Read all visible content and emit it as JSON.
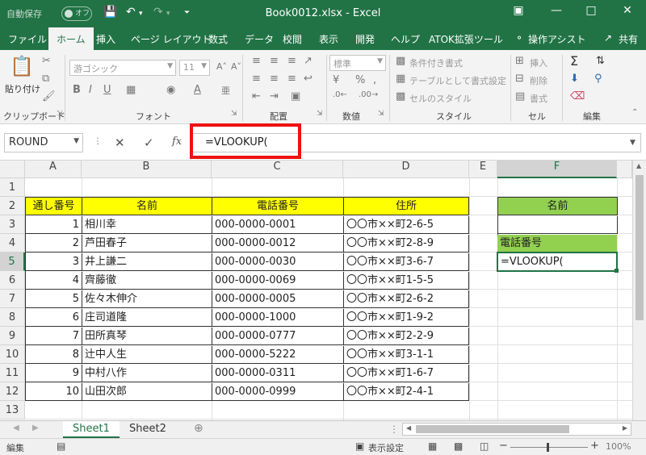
{
  "titlebar": {
    "autosave_label": "自動保存",
    "autosave_state": "オフ",
    "title": "Book0012.xlsx  -  Excel"
  },
  "ribbon_tabs": [
    "ファイル",
    "ホーム",
    "挿入",
    "ページ レイアウト",
    "数式",
    "データ",
    "校閲",
    "表示",
    "開発",
    "ヘルプ",
    "ATOK拡張ツール"
  ],
  "tell_me": "操作アシスト",
  "share": "共有",
  "ribbon": {
    "paste": "貼り付け",
    "font_name": "游ゴシック",
    "font_size": "11",
    "number_format": "標準",
    "conditional_format": "条件付き書式",
    "format_as_table": "テーブルとして書式設定",
    "cell_styles": "セルのスタイル",
    "insert": "挿入",
    "delete": "削除",
    "format": "書式",
    "groups": {
      "clipboard": "クリップボード",
      "font": "フォント",
      "alignment": "配置",
      "number": "数値",
      "styles": "スタイル",
      "cells": "セル",
      "editing": "編集"
    }
  },
  "formula_bar": {
    "name_box": "ROUND",
    "fx": "fx",
    "formula": "=VLOOKUP("
  },
  "grid": {
    "columns": [
      "A",
      "B",
      "C",
      "D",
      "E",
      "F"
    ],
    "rows": [
      "1",
      "2",
      "3",
      "4",
      "5",
      "6",
      "7",
      "8",
      "9",
      "10",
      "11",
      "12",
      "13"
    ],
    "headers": [
      "通し番号",
      "名前",
      "電話番号",
      "住所"
    ],
    "records": [
      [
        "1",
        "相川幸",
        "000-0000-0001",
        "〇〇市××町2-6-5"
      ],
      [
        "2",
        "芦田春子",
        "000-0000-0012",
        "〇〇市××町2-8-9"
      ],
      [
        "3",
        "井上謙二",
        "000-0000-0030",
        "〇〇市××町3-6-7"
      ],
      [
        "4",
        "齊藤徹",
        "000-0000-0069",
        "〇〇市××町1-5-5"
      ],
      [
        "5",
        "佐々木伸介",
        "000-0000-0005",
        "〇〇市××町2-6-2"
      ],
      [
        "6",
        "庄司道隆",
        "000-0000-1000",
        "〇〇市××町1-9-2"
      ],
      [
        "7",
        "田所真琴",
        "000-0000-0777",
        "〇〇市××町2-2-9"
      ],
      [
        "8",
        "辻中人生",
        "000-0000-5222",
        "〇〇市××町3-1-1"
      ],
      [
        "9",
        "中村八作",
        "000-0000-0311",
        "〇〇市××町1-6-7"
      ],
      [
        "10",
        "山田次郎",
        "000-0000-0999",
        "〇〇市××町2-4-1"
      ]
    ],
    "lookup_name_label": "名前",
    "lookup_name_value": "",
    "lookup_phone_label": "電話番号",
    "lookup_phone_value": "=VLOOKUP("
  },
  "sheets": [
    "Sheet1",
    "Sheet2"
  ],
  "status": {
    "mode": "編集",
    "display_settings": "表示設定",
    "zoom": "100%"
  },
  "colors": {
    "excel_green": "#217346",
    "header_yellow": "#ffff00",
    "lookup_green": "#92d050",
    "highlight_red": "#ee1111"
  }
}
